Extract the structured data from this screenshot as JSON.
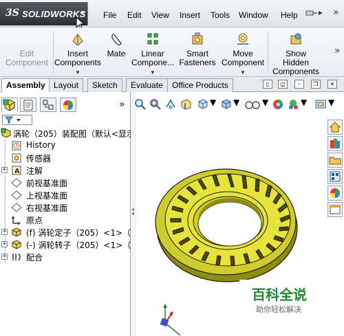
{
  "app": {
    "brand": "SOLIDWORKS",
    "brand_prefix": "3S"
  },
  "menu": {
    "items": [
      "File",
      "Edit",
      "View",
      "Insert",
      "Tools",
      "Window",
      "Help"
    ]
  },
  "command_manager": {
    "items": [
      {
        "label": "Edit\nComponent",
        "icon": "edit-component-icon",
        "disabled": true
      },
      {
        "label": "Insert\nComponents",
        "icon": "insert-components-icon",
        "disabled": false
      },
      {
        "label": "Mate",
        "icon": "mate-icon",
        "disabled": false
      },
      {
        "label": "Linear\nCompone...",
        "icon": "linear-pattern-icon",
        "disabled": false
      },
      {
        "label": "Smart\nFasteners",
        "icon": "smart-fasteners-icon",
        "disabled": false
      },
      {
        "label": "Move\nComponent",
        "icon": "move-component-icon",
        "disabled": false
      },
      {
        "label": "Show\nHidden\nComponents",
        "icon": "show-hidden-icon",
        "disabled": false
      }
    ]
  },
  "tabs": {
    "items": [
      "Assembly",
      "Layout",
      "Sketch",
      "Evaluate",
      "Office Products"
    ],
    "active": "Assembly"
  },
  "feature_tree": {
    "root": "涡轮（205）装配图（默认<显示",
    "items": [
      {
        "label": "History",
        "icon": "history-icon"
      },
      {
        "label": "传感器",
        "icon": "sensor-icon"
      },
      {
        "label": "注解",
        "icon": "annotation-icon"
      },
      {
        "label": "前视基准面",
        "icon": "plane-icon"
      },
      {
        "label": "上视基准面",
        "icon": "plane-icon"
      },
      {
        "label": "右视基准面",
        "icon": "plane-icon"
      },
      {
        "label": "原点",
        "icon": "origin-icon"
      },
      {
        "label": "(f) 涡轮定子（205）<1>（默",
        "icon": "part-icon"
      },
      {
        "label": "(-) 涡轮转子（205）<1>（默",
        "icon": "part-icon"
      },
      {
        "label": "配合",
        "icon": "mates-icon"
      }
    ]
  },
  "colors": {
    "accent": "#1e8a2f",
    "model_fill": "#e6e33c",
    "model_shadow": "#8f8c12"
  },
  "watermark": {
    "title": "百科全说",
    "subtitle": "助你轻松解决"
  }
}
